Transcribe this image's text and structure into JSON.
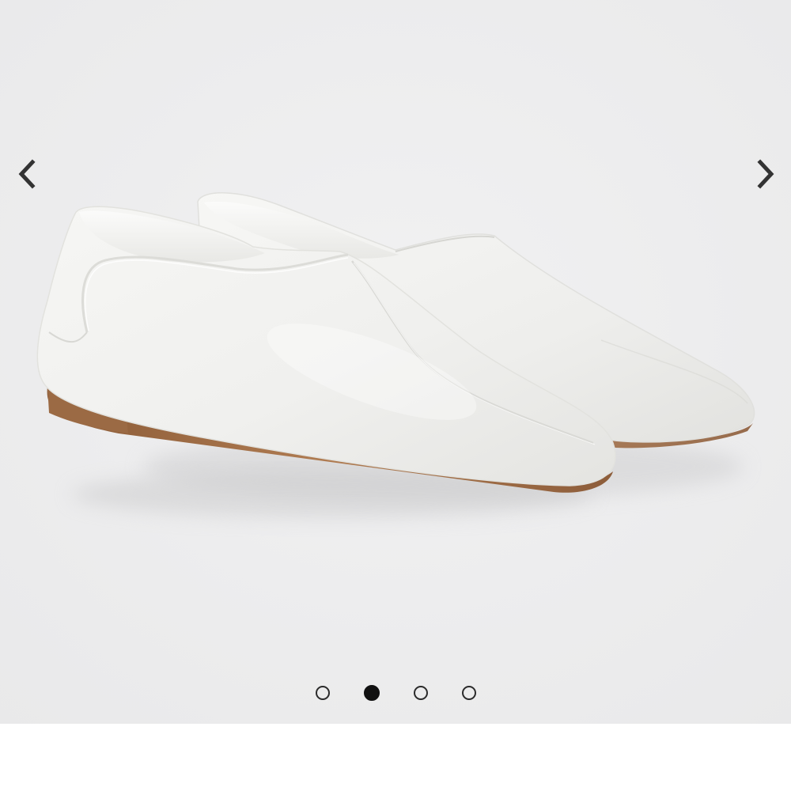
{
  "gallery": {
    "background_color": "#ededee",
    "image": {
      "subject": "product-photo",
      "description_icon": "loafer-pair-image"
    },
    "prev_icon": "chevron-left-icon",
    "next_icon": "chevron-right-icon",
    "slide_count": 4,
    "active_slide": 2,
    "colors": {
      "arrow": "#333333",
      "dot_active": "#111111",
      "dot_inactive_border": "#2b2b2b",
      "shoe": "#f4f4f2",
      "sole": "#a06c44"
    }
  }
}
